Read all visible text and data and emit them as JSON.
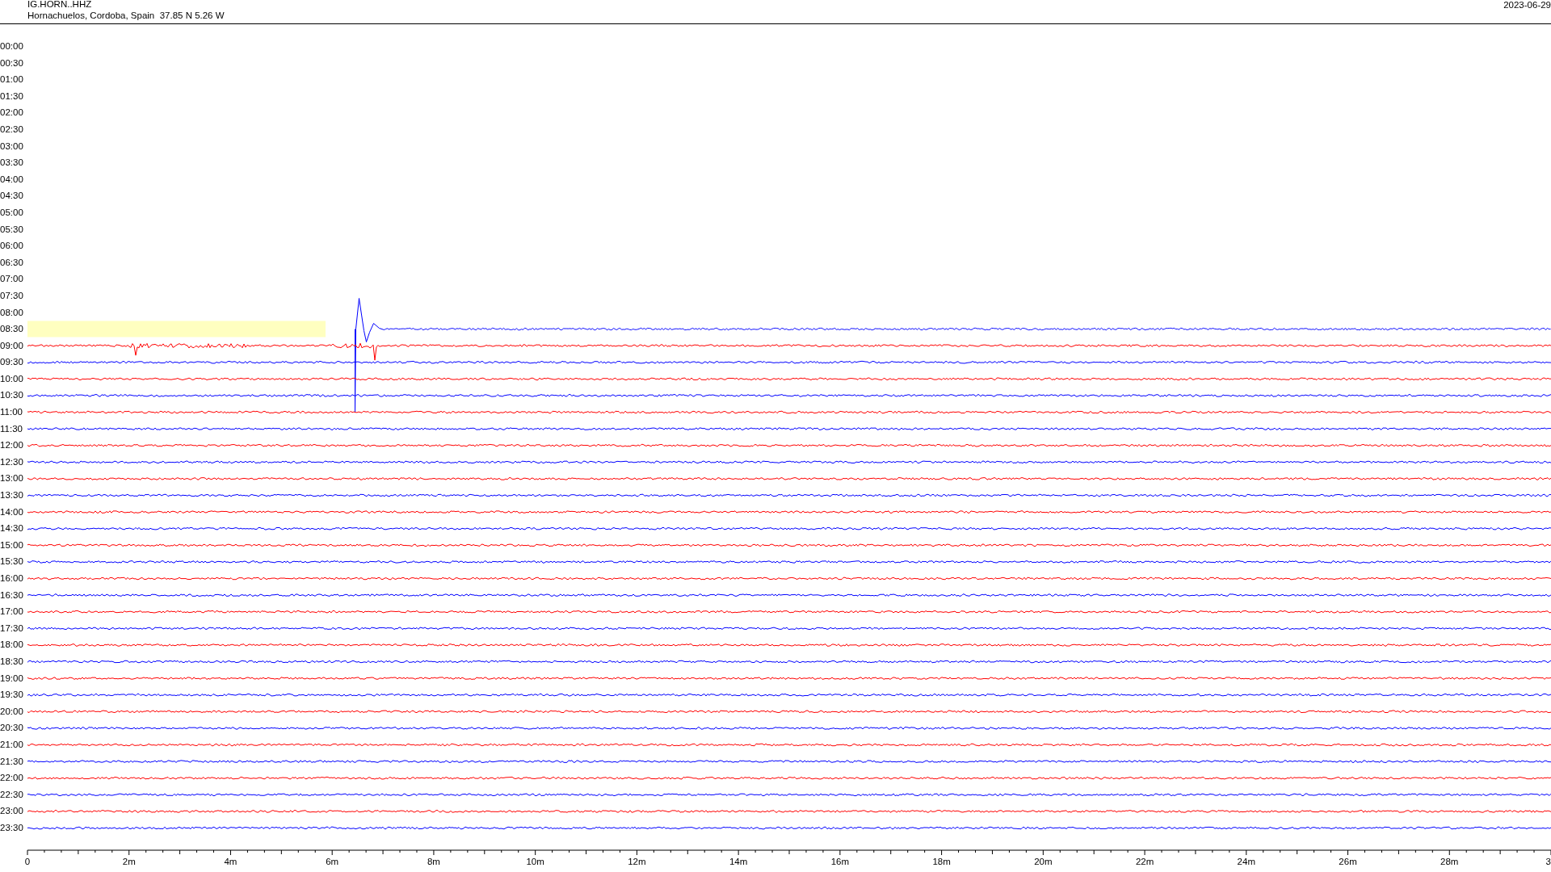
{
  "header": {
    "station": "IG.HORN..HHZ",
    "location": "Hornachuelos, Cordoba, Spain  37.85 N 5.26 W",
    "date": "2023-06-29"
  },
  "rows": [
    {
      "time": "00:00",
      "kind": "empty"
    },
    {
      "time": "00:30",
      "kind": "empty"
    },
    {
      "time": "01:00",
      "kind": "empty"
    },
    {
      "time": "01:30",
      "kind": "empty"
    },
    {
      "time": "02:00",
      "kind": "empty"
    },
    {
      "time": "02:30",
      "kind": "empty"
    },
    {
      "time": "03:00",
      "kind": "empty"
    },
    {
      "time": "03:30",
      "kind": "empty"
    },
    {
      "time": "04:00",
      "kind": "empty"
    },
    {
      "time": "04:30",
      "kind": "empty"
    },
    {
      "time": "05:00",
      "kind": "empty"
    },
    {
      "time": "05:30",
      "kind": "empty"
    },
    {
      "time": "06:00",
      "kind": "empty"
    },
    {
      "time": "06:30",
      "kind": "empty"
    },
    {
      "time": "07:00",
      "kind": "empty"
    },
    {
      "time": "07:30",
      "kind": "empty"
    },
    {
      "time": "08:00",
      "kind": "empty"
    },
    {
      "time": "08:30",
      "kind": "event",
      "color": "#0000ff",
      "highlighted": true
    },
    {
      "time": "09:00",
      "kind": "burst",
      "color": "#ff0000"
    },
    {
      "time": "09:30",
      "kind": "trace",
      "color": "#0000ff"
    },
    {
      "time": "10:00",
      "kind": "trace",
      "color": "#ff0000"
    },
    {
      "time": "10:30",
      "kind": "trace",
      "color": "#0000ff"
    },
    {
      "time": "11:00",
      "kind": "trace",
      "color": "#ff0000"
    },
    {
      "time": "11:30",
      "kind": "trace",
      "color": "#0000ff"
    },
    {
      "time": "12:00",
      "kind": "trace",
      "color": "#ff0000"
    },
    {
      "time": "12:30",
      "kind": "trace",
      "color": "#0000ff"
    },
    {
      "time": "13:00",
      "kind": "trace",
      "color": "#ff0000"
    },
    {
      "time": "13:30",
      "kind": "trace",
      "color": "#0000ff"
    },
    {
      "time": "14:00",
      "kind": "trace",
      "color": "#ff0000"
    },
    {
      "time": "14:30",
      "kind": "trace",
      "color": "#0000ff"
    },
    {
      "time": "15:00",
      "kind": "trace",
      "color": "#ff0000"
    },
    {
      "time": "15:30",
      "kind": "trace",
      "color": "#0000ff"
    },
    {
      "time": "16:00",
      "kind": "trace",
      "color": "#ff0000"
    },
    {
      "time": "16:30",
      "kind": "trace",
      "color": "#0000ff"
    },
    {
      "time": "17:00",
      "kind": "trace",
      "color": "#ff0000"
    },
    {
      "time": "17:30",
      "kind": "trace",
      "color": "#0000ff"
    },
    {
      "time": "18:00",
      "kind": "trace",
      "color": "#ff0000"
    },
    {
      "time": "18:30",
      "kind": "trace",
      "color": "#0000ff"
    },
    {
      "time": "19:00",
      "kind": "trace",
      "color": "#ff0000"
    },
    {
      "time": "19:30",
      "kind": "trace",
      "color": "#0000ff"
    },
    {
      "time": "20:00",
      "kind": "trace",
      "color": "#ff0000"
    },
    {
      "time": "20:30",
      "kind": "trace",
      "color": "#0000ff"
    },
    {
      "time": "21:00",
      "kind": "trace",
      "color": "#ff0000"
    },
    {
      "time": "21:30",
      "kind": "trace",
      "color": "#0000ff"
    },
    {
      "time": "22:00",
      "kind": "trace",
      "color": "#ff0000"
    },
    {
      "time": "22:30",
      "kind": "trace",
      "color": "#0000ff"
    },
    {
      "time": "23:00",
      "kind": "trace",
      "color": "#ff0000"
    },
    {
      "time": "23:30",
      "kind": "trace",
      "color": "#0000ff"
    }
  ],
  "x_axis": {
    "labels": [
      "0",
      "2m",
      "4m",
      "6m",
      "8m",
      "10m",
      "12m",
      "14m",
      "16m",
      "18m",
      "20m",
      "22m",
      "24m",
      "26m",
      "28m",
      "3"
    ]
  }
}
